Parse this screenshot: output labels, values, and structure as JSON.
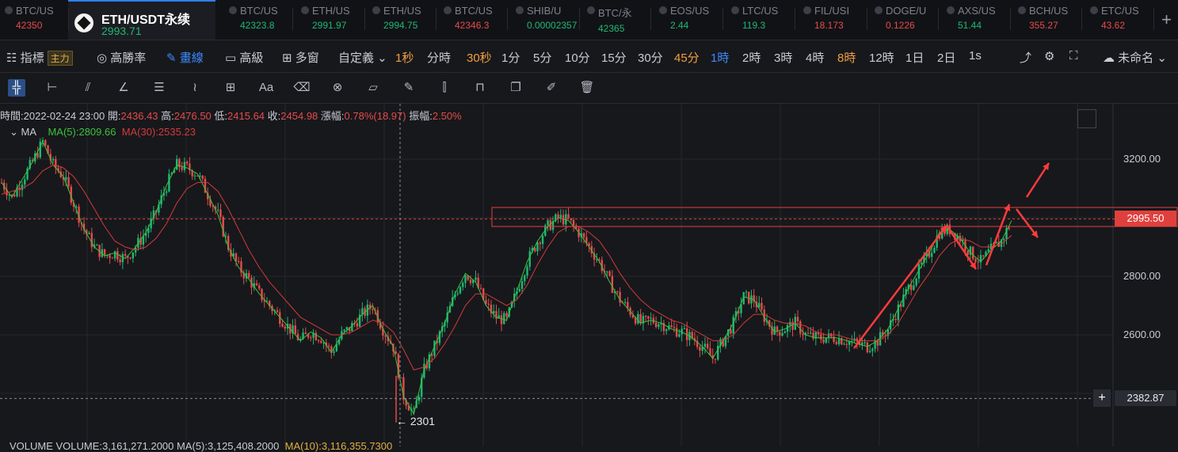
{
  "tickers": [
    {
      "name": "BTC/US",
      "price": "42350",
      "dir": "dn",
      "x": 0,
      "w": 78
    },
    {
      "name": "BTC/US",
      "price": "42323.8",
      "dir": "up",
      "x": 283,
      "w": 78
    },
    {
      "name": "ETH/US",
      "price": "2991.97",
      "dir": "up",
      "x": 374,
      "w": 78
    },
    {
      "name": "ETH/US",
      "price": "2994.75",
      "dir": "up",
      "x": 464,
      "w": 78
    },
    {
      "name": "BTC/US",
      "price": "42346.3",
      "dir": "dn",
      "x": 554,
      "w": 78
    },
    {
      "name": "SHIB/U",
      "price": "0.00002357",
      "dir": "up",
      "x": 645,
      "w": 78
    },
    {
      "name": "BTC/永",
      "price": "42365",
      "dir": "up",
      "x": 735,
      "w": 78
    },
    {
      "name": "EOS/US",
      "price": "2.44",
      "dir": "up",
      "x": 826,
      "w": 78
    },
    {
      "name": "LTC/US",
      "price": "119.3",
      "dir": "up",
      "x": 917,
      "w": 78
    },
    {
      "name": "FIL/USI",
      "price": "18.173",
      "dir": "dn",
      "x": 1008,
      "w": 78
    },
    {
      "name": "DOGE/U",
      "price": "0.1226",
      "dir": "dn",
      "x": 1098,
      "w": 78
    },
    {
      "name": "AXS/US",
      "price": "51.44",
      "dir": "up",
      "x": 1189,
      "w": 78
    },
    {
      "name": "BCH/US",
      "price": "355.27",
      "dir": "dn",
      "x": 1279,
      "w": 78
    },
    {
      "name": "ETC/US",
      "price": "43.62",
      "dir": "dn",
      "x": 1370,
      "w": 78
    }
  ],
  "active": {
    "symbol": "ETH/USDT永续",
    "price": "2993.71"
  },
  "timebar": {
    "indicator": "指標",
    "badge": "主力",
    "winrate": "高勝率",
    "draw": "畫線",
    "advanced": "高級",
    "multi": "多窗",
    "custom": "自定義",
    "intervals": [
      {
        "label": "1秒",
        "style": "orange"
      },
      {
        "label": "分時",
        "style": ""
      },
      {
        "label": "30秒",
        "style": "orange"
      },
      {
        "label": "1分",
        "style": ""
      },
      {
        "label": "5分",
        "style": ""
      },
      {
        "label": "10分",
        "style": ""
      },
      {
        "label": "15分",
        "style": ""
      },
      {
        "label": "30分",
        "style": ""
      },
      {
        "label": "45分",
        "style": "orange"
      },
      {
        "label": "1時",
        "style": "blue"
      },
      {
        "label": "2時",
        "style": ""
      },
      {
        "label": "3時",
        "style": ""
      },
      {
        "label": "4時",
        "style": ""
      },
      {
        "label": "8時",
        "style": "orange"
      },
      {
        "label": "12時",
        "style": ""
      },
      {
        "label": "1日",
        "style": ""
      },
      {
        "label": "2日",
        "style": ""
      },
      {
        "label": "1s",
        "style": ""
      }
    ],
    "unnamed": "未命名"
  },
  "draw_tools": [
    "crosshair-icon",
    "horizontal-line-icon",
    "parallel-lines-icon",
    "angle-icon",
    "fib-lines-icon",
    "wave-icon",
    "measure-icon",
    "text-tool-icon",
    "eraser-icon",
    "magnet-icon",
    "ruler-icon",
    "pen-icon",
    "candles-icon",
    "lock-icon",
    "copy-icon",
    "edit-icon",
    "trash-icon"
  ],
  "text_tool_label": "Aa",
  "info": {
    "time_label": "時間:",
    "time": "2022-02-24 23:00",
    "open_label": "開:",
    "open": "2436.43",
    "high_label": "高:",
    "high": "2476.50",
    "low_label": "低:",
    "low": "2415.64",
    "close_label": "收:",
    "close": "2454.98",
    "change_label": "漲幅:",
    "change": "0.78%(18.97)",
    "amp_label": "振幅:",
    "amp": "2.50%"
  },
  "ma": {
    "label": "MA",
    "ma5": "MA(5):2809.66",
    "ma30": "MA(30):2535.23"
  },
  "price_tag": "2995.50",
  "cross_tag": "2382.87",
  "low_label": "← 2301",
  "volume_text": "VOLUME   VOLUME:3,161,271.2000  MA(5):3,125,408.2000",
  "volume_ma10": "MA(10):3,116,355.7300",
  "colors": {
    "up": "#1fb874",
    "down": "#e44b4b",
    "ma5": "#3cc13c",
    "ma30": "#d33a3a",
    "accent": "#3d8bff"
  },
  "chart_data": {
    "type": "candlestick",
    "y_ticks": [
      3200,
      2800,
      2600
    ],
    "y_tick_labels": [
      "3200.00",
      "2800.00",
      "2600.00"
    ],
    "ylim": [
      2260,
      3320
    ],
    "series": [
      {
        "name": "MA(5)",
        "value_last": 2809.66
      },
      {
        "name": "MA(30)",
        "value_last": 2535.23
      }
    ],
    "close_path": [
      3120,
      3070,
      3130,
      3190,
      3260,
      3180,
      3140,
      3050,
      2960,
      2900,
      2870,
      2880,
      2860,
      2900,
      2950,
      3020,
      3110,
      3180,
      3170,
      3150,
      3080,
      3010,
      2900,
      2830,
      2790,
      2740,
      2700,
      2660,
      2620,
      2580,
      2610,
      2590,
      2540,
      2600,
      2630,
      2670,
      2700,
      2620,
      2560,
      2390,
      2330,
      2480,
      2560,
      2640,
      2740,
      2810,
      2780,
      2700,
      2660,
      2650,
      2750,
      2850,
      2920,
      2970,
      3000,
      2990,
      2950,
      2900,
      2850,
      2780,
      2720,
      2680,
      2640,
      2650,
      2640,
      2620,
      2610,
      2590,
      2560,
      2520,
      2580,
      2640,
      2730,
      2720,
      2660,
      2610,
      2620,
      2640,
      2600,
      2590,
      2590,
      2590,
      2580,
      2570,
      2560,
      2580,
      2620,
      2690,
      2760,
      2820,
      2880,
      2950,
      2960,
      2930,
      2880,
      2850,
      2890,
      2920,
      2990
    ],
    "ma30_path": [
      3080,
      3090,
      3100,
      3120,
      3160,
      3180,
      3170,
      3140,
      3090,
      3030,
      2970,
      2920,
      2900,
      2890,
      2900,
      2930,
      2980,
      3050,
      3100,
      3120,
      3120,
      3090,
      3030,
      2960,
      2890,
      2830,
      2780,
      2740,
      2700,
      2660,
      2640,
      2620,
      2600,
      2600,
      2610,
      2630,
      2650,
      2640,
      2610,
      2550,
      2480,
      2490,
      2520,
      2570,
      2630,
      2700,
      2740,
      2740,
      2720,
      2700,
      2720,
      2770,
      2840,
      2900,
      2950,
      2970,
      2970,
      2950,
      2920,
      2870,
      2810,
      2760,
      2720,
      2690,
      2670,
      2650,
      2640,
      2620,
      2600,
      2580,
      2580,
      2600,
      2640,
      2670,
      2670,
      2650,
      2640,
      2640,
      2630,
      2610,
      2600,
      2600,
      2590,
      2580,
      2580,
      2580,
      2600,
      2640,
      2700,
      2760,
      2810,
      2870,
      2910,
      2930,
      2920,
      2900,
      2900,
      2910,
      2940
    ],
    "resistance_zone": [
      2970,
      3035
    ],
    "current_price": 2995.5,
    "crosshair_price": 2382.87,
    "low_marker": 2301
  }
}
